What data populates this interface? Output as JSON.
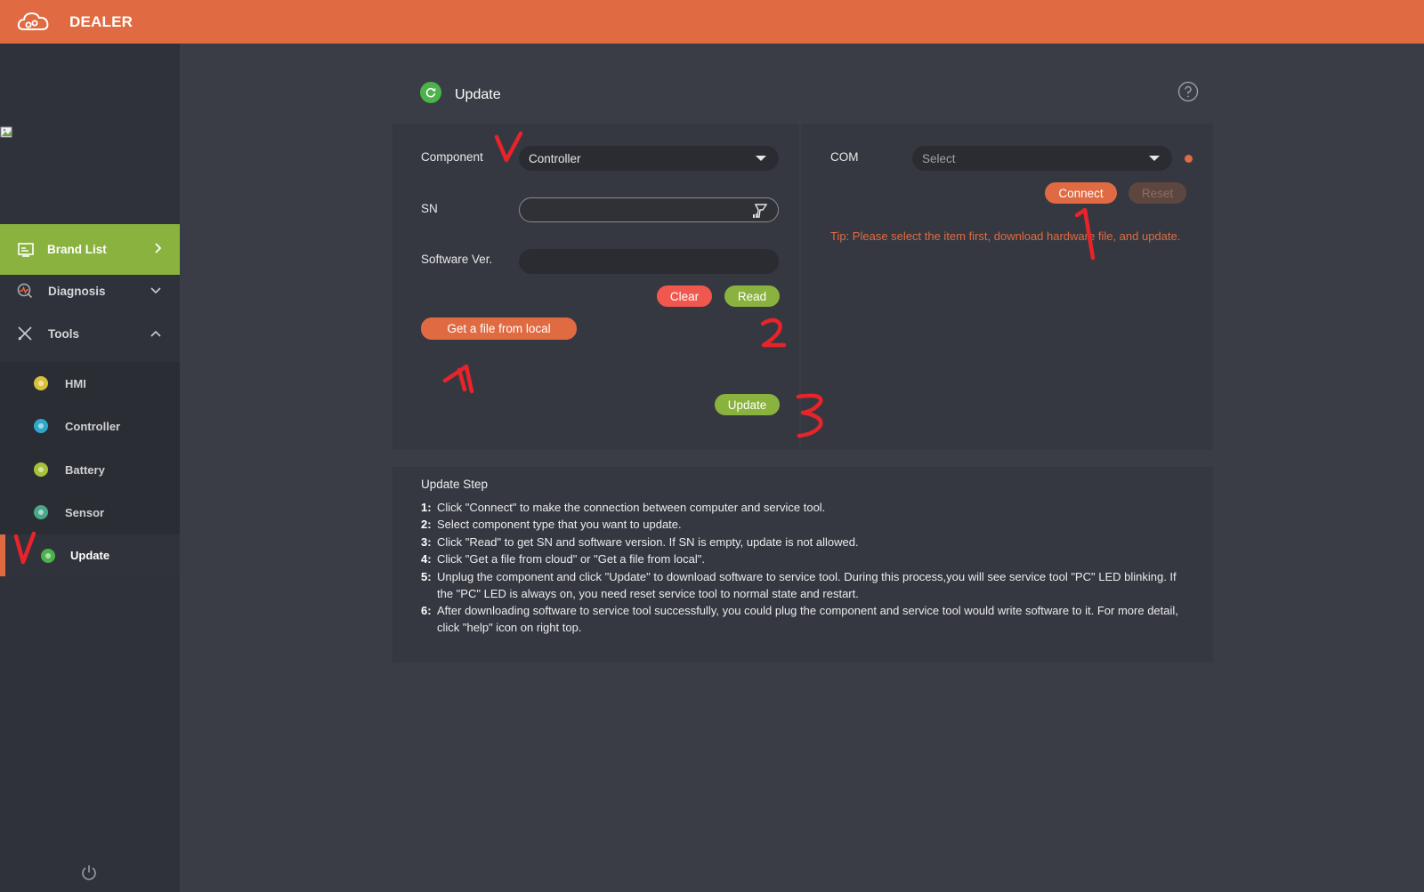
{
  "app": {
    "title": "DEALER"
  },
  "sidebar": {
    "brand_list": "Brand List",
    "diagnosis": "Diagnosis",
    "tools": "Tools",
    "sub_items": [
      {
        "label": "HMI",
        "color": "#d9c23a"
      },
      {
        "label": "Controller",
        "color": "#2ea8c9"
      },
      {
        "label": "Battery",
        "color": "#a5c23a"
      },
      {
        "label": "Sensor",
        "color": "#4aa889"
      },
      {
        "label": "Update",
        "color": "#4cb24a"
      }
    ]
  },
  "page": {
    "title": "Update"
  },
  "form": {
    "component_label": "Component",
    "component_value": "Controller",
    "sn_label": "SN",
    "sn_value": "",
    "software_label": "Software Ver.",
    "software_value": "",
    "clear_label": "Clear",
    "read_label": "Read",
    "local_label": "Get a file from local",
    "update_label": "Update"
  },
  "com": {
    "label": "COM",
    "placeholder": "Select",
    "connect_label": "Connect",
    "reset_label": "Reset",
    "tip": "Tip: Please select the item first, download hardware file, and update."
  },
  "steps": {
    "title": "Update Step",
    "items": [
      {
        "num": "1:",
        "text": "Click \"Connect\" to make the connection between computer and service tool."
      },
      {
        "num": "2:",
        "text": "Select component type that you want to update."
      },
      {
        "num": "3:",
        "text": "Click \"Read\" to get SN and software version. If SN is empty, update is not allowed."
      },
      {
        "num": "4:",
        "text": "Click \"Get a file from cloud\" or \"Get a file from local\"."
      },
      {
        "num": "5:",
        "text": "Unplug the component and click \"Update\" to download software to service tool. During this process,you will see service tool \"PC\" LED blinking. If the \"PC\" LED is always on, you need reset service tool to normal state and restart."
      },
      {
        "num": "6:",
        "text": "After downloading software to service tool successfully, you could plug the component and service tool would write software to it. For more detail, click \"help\" icon on right top."
      }
    ]
  },
  "colors": {
    "accent": "#e06b42",
    "green": "#8ab23f",
    "red": "#f0584f",
    "annotation": "#e8242a"
  }
}
